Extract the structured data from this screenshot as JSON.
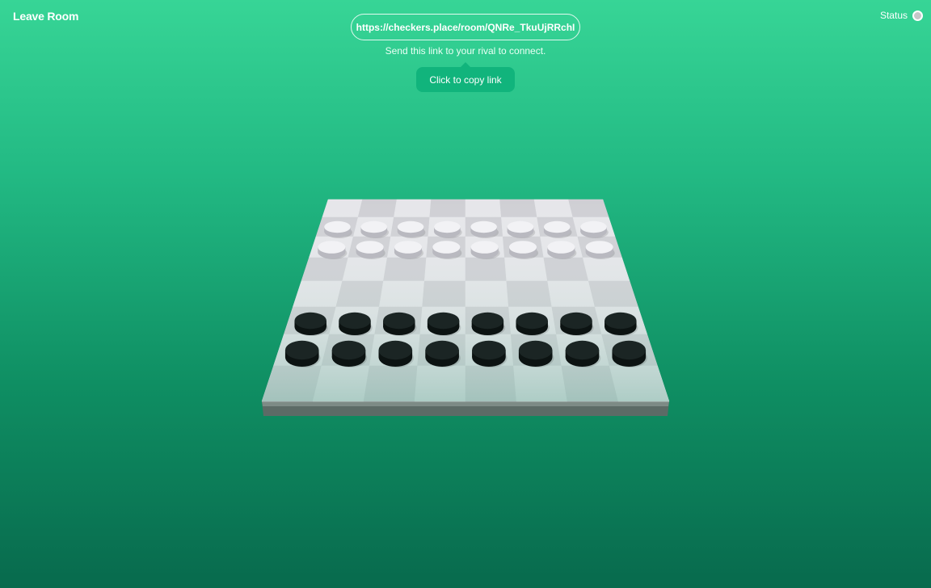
{
  "header": {
    "leave_label": "Leave Room",
    "status_label": "Status"
  },
  "invite": {
    "url": "https://checkers.place/room/QNRe_TkuUjRRchI",
    "hint": "Send this link to your rival to connect.",
    "copy_label": "Click to copy link"
  },
  "game": {
    "board_size": 8,
    "white_piece_rows": [
      1,
      2
    ],
    "black_piece_rows": [
      5,
      6
    ],
    "colors": {
      "background_top": "#37d596",
      "background_bottom": "#086a4d",
      "light_square": "#e6e6ea",
      "dark_square": "#cfcfd4",
      "white_piece": "#f2f2f5",
      "black_piece": "#1b2524"
    }
  }
}
